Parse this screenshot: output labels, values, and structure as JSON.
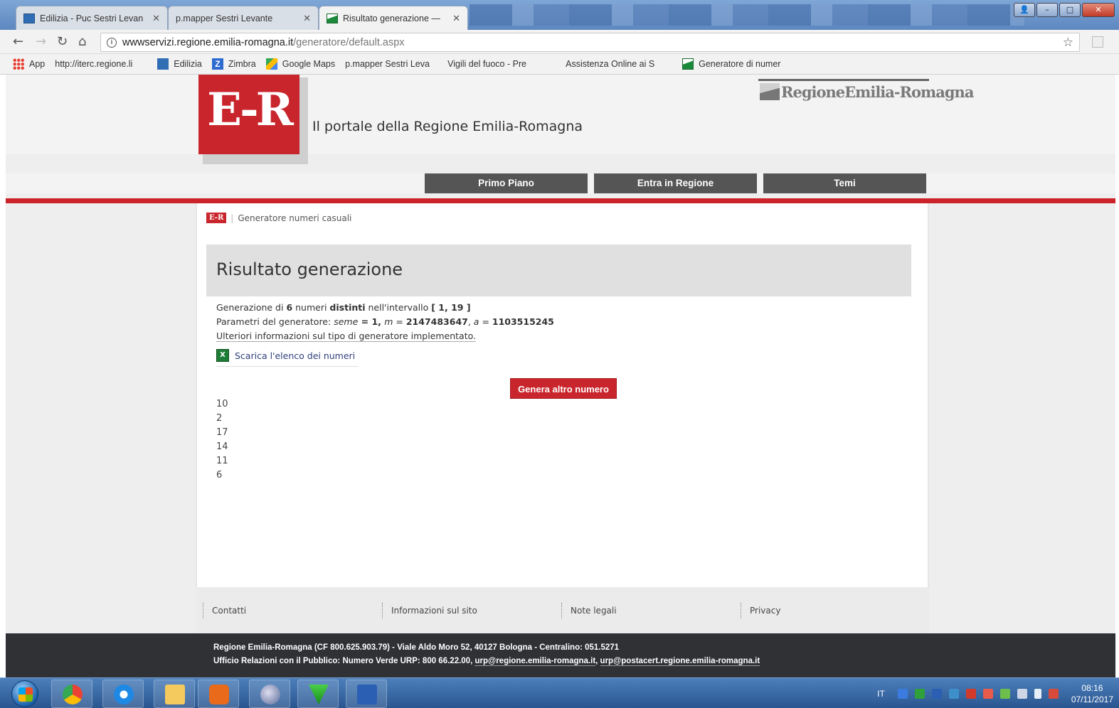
{
  "browser": {
    "tabs": [
      {
        "title": "Edilizia - Puc Sestri Levan",
        "icon": "blue-doc-icon"
      },
      {
        "title": "p.mapper Sestri Levante",
        "icon": "page-icon"
      },
      {
        "title": "Risultato generazione —",
        "icon": "flag-icon"
      }
    ],
    "address": {
      "host": "wwwservizi.regione.emilia-romagna.it",
      "path": "/generatore/default.aspx"
    },
    "bookmarks": [
      {
        "label": "App",
        "icon": "apps-icon"
      },
      {
        "label": "http://iterc.regione.li",
        "icon": "page-icon"
      },
      {
        "label": "Edilizia",
        "icon": "blue-doc-icon"
      },
      {
        "label": "Zimbra",
        "icon": "zimbra-icon"
      },
      {
        "label": "Google Maps",
        "icon": "maps-icon"
      },
      {
        "label": "p.mapper Sestri Leva",
        "icon": "page-icon"
      },
      {
        "label": "Vigili del fuoco - Pre",
        "icon": "page-icon"
      },
      {
        "label": "Assistenza Online ai S",
        "icon": "page-icon"
      },
      {
        "label": "Generatore di numer",
        "icon": "flag-icon"
      }
    ]
  },
  "site": {
    "logo_text": "E-R",
    "tagline": "Il portale della Regione Emilia-Romagna",
    "brand": "RegioneEmilia-Romagna",
    "nav": [
      "Primo Piano",
      "Entra in Regione",
      "Temi"
    ]
  },
  "content": {
    "breadcrumb_badge": "E-R",
    "breadcrumb": "Generatore numeri casuali",
    "title": "Risultato generazione",
    "line1": {
      "pre": "Generazione di ",
      "count": "6",
      "mid": " numeri ",
      "kind": "distinti",
      "post": " nell'intervallo ",
      "range": "[ 1, 19 ]"
    },
    "line2": {
      "pre": "Parametri del generatore: ",
      "seme_label": "seme",
      "seme_val": " = 1, ",
      "m_label": "m",
      "m_val": "2147483647",
      "a_label": "a",
      "a_val": "1103515245"
    },
    "line3": "Ulteriori informazioni sul tipo di generatore implementato.",
    "download": "Scarica l'elenco dei numeri",
    "button": "Genera altro numero",
    "numbers": [
      "10",
      "2",
      "17",
      "14",
      "11",
      "6"
    ]
  },
  "footer": {
    "links": [
      "Contatti",
      "Informazioni sul sito",
      "Note legali",
      "Privacy"
    ],
    "line1": "Regione Emilia-Romagna (CF 800.625.903.79) - Viale Aldo Moro 52, 40127 Bologna - Centralino: 051.5271",
    "line2_pre": "Ufficio Relazioni con il Pubblico: Numero Verde URP: 800 66.22.00, ",
    "email1": "urp@regione.emilia-romagna.it",
    "sep": ", ",
    "email2": "urp@postacert.regione.emilia-romagna.it"
  },
  "taskbar": {
    "lang": "IT",
    "time": "08:16",
    "date": "07/11/2017"
  }
}
